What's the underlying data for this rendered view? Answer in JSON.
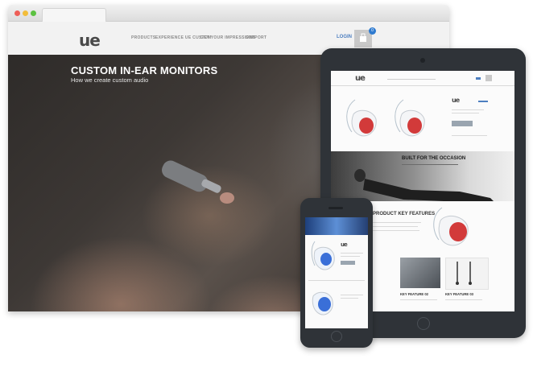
{
  "desktop": {
    "logo": "ue",
    "nav": [
      "PRODUCTS",
      "EXPERIENCE UE CUSTOM",
      "GET YOUR IMPRESSIONS",
      "SUPPORT"
    ],
    "login": "LOGIN",
    "cart_count": "0",
    "hero_title": "CUSTOM IN-EAR MONITORS",
    "hero_subtitle": "How we create custom audio"
  },
  "tablet": {
    "logo": "ue",
    "product_logo": "ue",
    "banner_title": "BUILT FOR THE OCCASION",
    "section_title": "PRODUCT KEY FEATURES",
    "features": [
      "KEY FEATURE 02",
      "KEY FEATURE 03"
    ]
  },
  "phone": {
    "product_logo": "ue"
  },
  "colors": {
    "accent_blue": "#2f7bd0",
    "earphone_red": "#d23a3a",
    "earphone_blue": "#3a6fd8",
    "device_frame": "#2f3338"
  }
}
